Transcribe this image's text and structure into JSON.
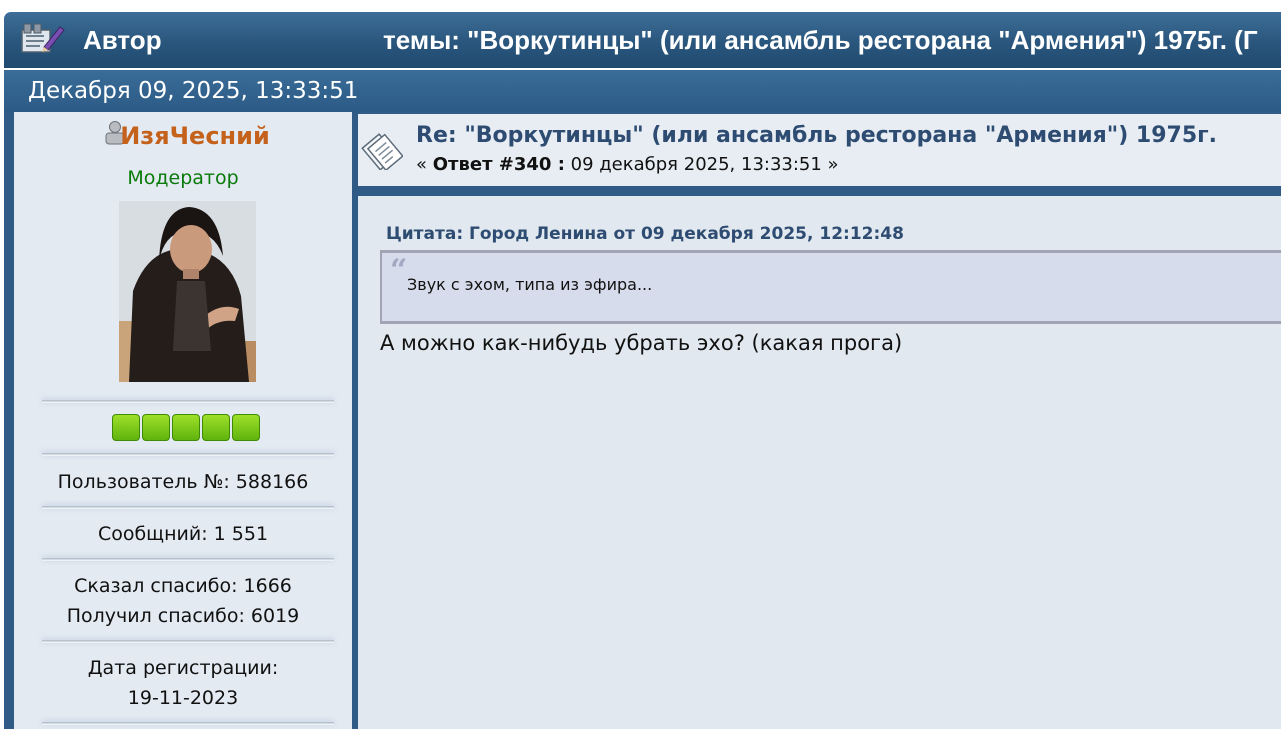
{
  "header": {
    "author_label": "Автор",
    "topic_title": "темы: \"Воркутинцы\" (или ансамбль ресторана \"Армения\") 1975г. (Г"
  },
  "datebar": {
    "date": "Декабря 09, 2025, 13:33:51"
  },
  "profile": {
    "username": "ИзяЧесний",
    "role": "Модератор",
    "stars_count": 5,
    "user_number": "Пользователь №: 588166",
    "messages": "Сообщний: 1 551",
    "thanks_given": "Сказал спасибо: 1666",
    "thanks_received": "Получил спасибо: 6019",
    "registration_label": "Дата регистрации:",
    "registration_date": "19-11-2023"
  },
  "post": {
    "title": "Re: \"Воркутинцы\" (или ансамбль ресторана \"Армения\") 1975г.",
    "meta_open": "« ",
    "reply_number": "Ответ #340 :",
    "meta_date": " 09 декабря 2025, 13:33:51 »",
    "quote_header": "Цитата: Город Ленина от 09 декабря 2025, 12:12:48",
    "quote_text": "Звук с эхом, типа из эфира...",
    "body": "А можно как-нибудь убрать эхо? (какая прога)"
  },
  "colors": {
    "header_blue": "#2a567d",
    "username_orange": "#c4621c",
    "moderator_green": "#0a7a0a",
    "link_blue": "#2e4c72",
    "star_green": "#7bcc14"
  },
  "icons": [
    "topic-edit-icon",
    "user-status-icon",
    "post-icon",
    "quote-mark-icon"
  ]
}
